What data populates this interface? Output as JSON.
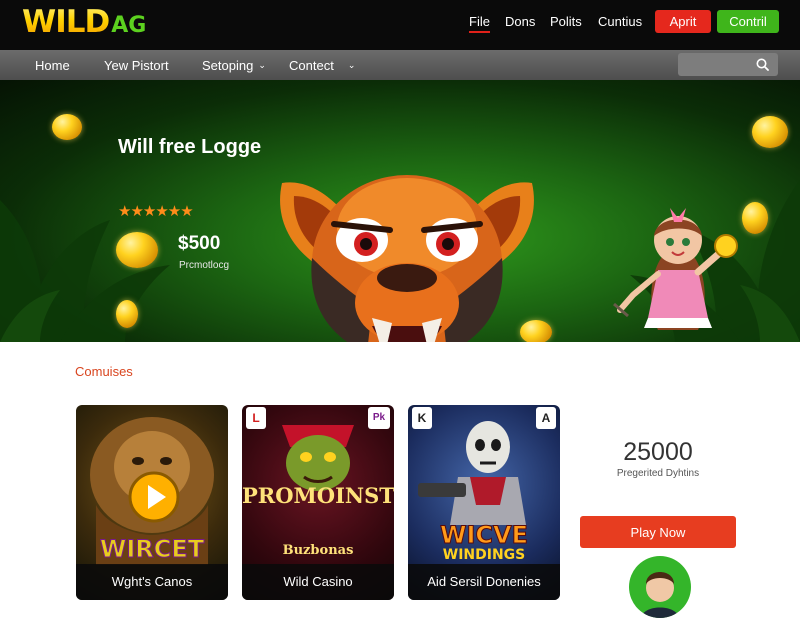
{
  "brand": {
    "logo_main": "WILD",
    "logo_suffix": "AG"
  },
  "top_nav": {
    "items": [
      {
        "label": "File",
        "active": true
      },
      {
        "label": "Dons",
        "active": false
      },
      {
        "label": "Polits",
        "active": false
      },
      {
        "label": "Cuntius",
        "active": false
      }
    ],
    "button_red": "Aprit",
    "button_green": "Contril"
  },
  "sub_nav": {
    "items": [
      {
        "label": "Home",
        "dropdown": false
      },
      {
        "label": "Yew Pistort",
        "dropdown": false
      },
      {
        "label": "Setoping",
        "dropdown": true
      },
      {
        "label": "Contect",
        "dropdown": true
      }
    ],
    "search": {
      "placeholder": "",
      "icon": "search-icon"
    }
  },
  "hero": {
    "title": "Will free Logge",
    "stars": "★★★★★★",
    "rating": 6,
    "amount": "$500",
    "subtitle": "Prcmotlocg"
  },
  "section": {
    "title": "Comuises",
    "cards": [
      {
        "art_text": "WIRCET",
        "caption": "Wght's Canos",
        "badge_left": "",
        "badge_right": ""
      },
      {
        "art_text": "PROMOINST",
        "art_subtext": "Buzbonas",
        "caption": "Wild Casino",
        "badge_left": "L",
        "badge_right": "Pk"
      },
      {
        "art_text": "WICVE",
        "art_subtext": "WINDINGS",
        "caption": "Aid Sersil Donenies",
        "badge_left": "K",
        "badge_right": "A"
      }
    ]
  },
  "stats": {
    "number": "25000",
    "label": "Pregerited Dyhtins"
  },
  "cta": {
    "label": "Play Now"
  },
  "colors": {
    "accent_red": "#e5281d",
    "accent_green": "#3fb51b",
    "section_title": "#d9451f",
    "play_button": "#e73d20"
  }
}
